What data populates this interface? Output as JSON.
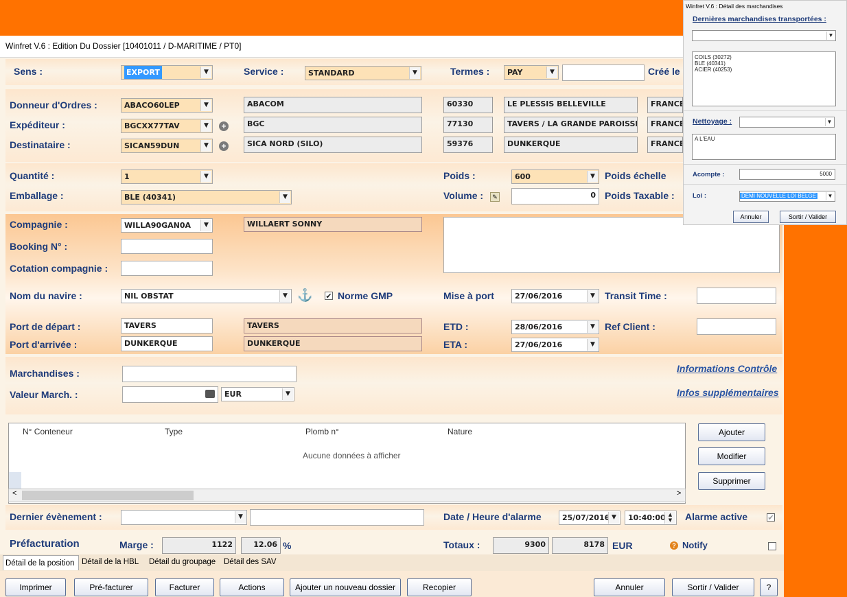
{
  "window": {
    "title": "Winfret V.6 : Edition Du Dossier [10401011 / D-MARITIME / PT0]"
  },
  "header": {
    "sens_label": "Sens :",
    "sens_value": "EXPORT",
    "service_label": "Service :",
    "service_value": "STANDARD",
    "termes_label": "Termes :",
    "termes_value": "PAY",
    "termes_extra": "",
    "cree_label": "Créé le"
  },
  "parties": {
    "donneur_label": "Donneur d'Ordres :",
    "donneur_code": "ABACO60LEP",
    "donneur_name": "ABACOM",
    "donneur_cp": "60330",
    "donneur_city": "LE PLESSIS BELLEVILLE",
    "donneur_country": "FRANCE",
    "expediteur_label": "Expéditeur :",
    "expediteur_code": "BGCXX77TAV",
    "expediteur_name": "BGC",
    "expediteur_cp": "77130",
    "expediteur_city": "TAVERS / LA GRANDE PAROISSE",
    "expediteur_country": "FRANCE",
    "destinataire_label": "Destinataire :",
    "destinataire_code": "SICAN59DUN",
    "destinataire_name": "SICA NORD (SILO)",
    "destinataire_cp": "59376",
    "destinataire_city": "DUNKERQUE",
    "destinataire_country": "FRANCE",
    "add_icon": "plus-circle-icon"
  },
  "goods": {
    "quantite_label": "Quantité :",
    "quantite_value": "1",
    "emballage_label": "Emballage :",
    "emballage_value": "BLE (40341)",
    "poids_label": "Poids :",
    "poids_value": "600",
    "poids_echelle_label": "Poids échelle",
    "volume_label": "Volume :",
    "volume_value": "0",
    "poids_taxable_label": "Poids Taxable :"
  },
  "compagnie": {
    "compagnie_label": "Compagnie :",
    "compagnie_code": "WILLA90GAN0A",
    "compagnie_name": "WILLAERT SONNY",
    "booking_label": "Booking N° :",
    "booking_value": "",
    "cotation_label": "Cotation compagnie :",
    "cotation_value": "",
    "notes_value": ""
  },
  "navire": {
    "nom_label": "Nom du navire :",
    "nom_value": "NIL OBSTAT",
    "norme_label": "Norme GMP",
    "norme_checked": "✔",
    "mise_label": "Mise à port",
    "mise_value": "27/06/2016",
    "transit_label": "Transit Time :",
    "transit_value": ""
  },
  "ports": {
    "depart_label": "Port de départ :",
    "depart_value": "TAVERS",
    "depart_name": "TAVERS",
    "arrivee_label": "Port d'arrivée :",
    "arrivee_value": "DUNKERQUE",
    "arrivee_name": "DUNKERQUE",
    "etd_label": "ETD :",
    "etd_value": "28/06/2016",
    "eta_label": "ETA :",
    "eta_value": "27/06/2016",
    "ref_label": "Ref Client :",
    "ref_value": ""
  },
  "marchandises": {
    "label": "Marchandises :",
    "value": "",
    "valeur_label": "Valeur March. :",
    "valeur_value": "",
    "currency": "EUR",
    "info_controle": "Informations Contrôle",
    "infos_supp": "Infos supplémentaires"
  },
  "containers": {
    "columns": [
      "N° Conteneur",
      "Type",
      "Plomb n°",
      "Nature"
    ],
    "empty_text": "Aucune données à afficher",
    "buttons": {
      "ajouter": "Ajouter",
      "modifier": "Modifier",
      "supprimer": "Supprimer"
    }
  },
  "event": {
    "dernier_label": "Dernier évènement :",
    "dernier_value": "",
    "dernier_text": "",
    "date_label": "Date / Heure d'alarme",
    "date_value": "25/07/2016",
    "heure_value": "10:40:00",
    "alarme_label": "Alarme active",
    "alarme_checked": "✔"
  },
  "prefact": {
    "title": "Préfacturation",
    "marge_label": "Marge :",
    "marge_value": "1122",
    "marge_pct": "12.06",
    "pct_sign": "%",
    "totaux_label": "Totaux :",
    "total1": "9300",
    "total2": "8178",
    "currency": "EUR",
    "notify_label": "Notify"
  },
  "tabs": [
    "Détail de la position",
    "Détail de la HBL",
    "Détail du groupage",
    "Détail des SAV"
  ],
  "footer": {
    "imprimer": "Imprimer",
    "prefacturer": "Pré-facturer",
    "facturer": "Facturer",
    "actions": "Actions",
    "ajouter_dossier": "Ajouter un nouveau dossier",
    "recopier": "Recopier",
    "annuler": "Annuler",
    "sortir": "Sortir / Valider",
    "help": "?"
  },
  "popup": {
    "title": "Winfret V.6 : Détail des marchandises",
    "dernieres_label": "Dernières marchandises transportées :",
    "dernieres_select": "",
    "list": [
      "COILS (30272)",
      "BLE (40341)",
      "ACIER (40253)"
    ],
    "nettoyage_label": "Nettoyage :",
    "nettoyage_value": "",
    "nettoyage_text": "A L'EAU",
    "acompte_label": "Acompte :",
    "acompte_value": "5000",
    "loi_label": "Loi :",
    "loi_value": "DEMI NOUVELLE LOI BELGE",
    "annuler": "Annuler",
    "sortir": "Sortir / Valider"
  },
  "colors": {
    "accent": "#ff7200",
    "label": "#1f3c7a",
    "link": "#2b55a3"
  }
}
